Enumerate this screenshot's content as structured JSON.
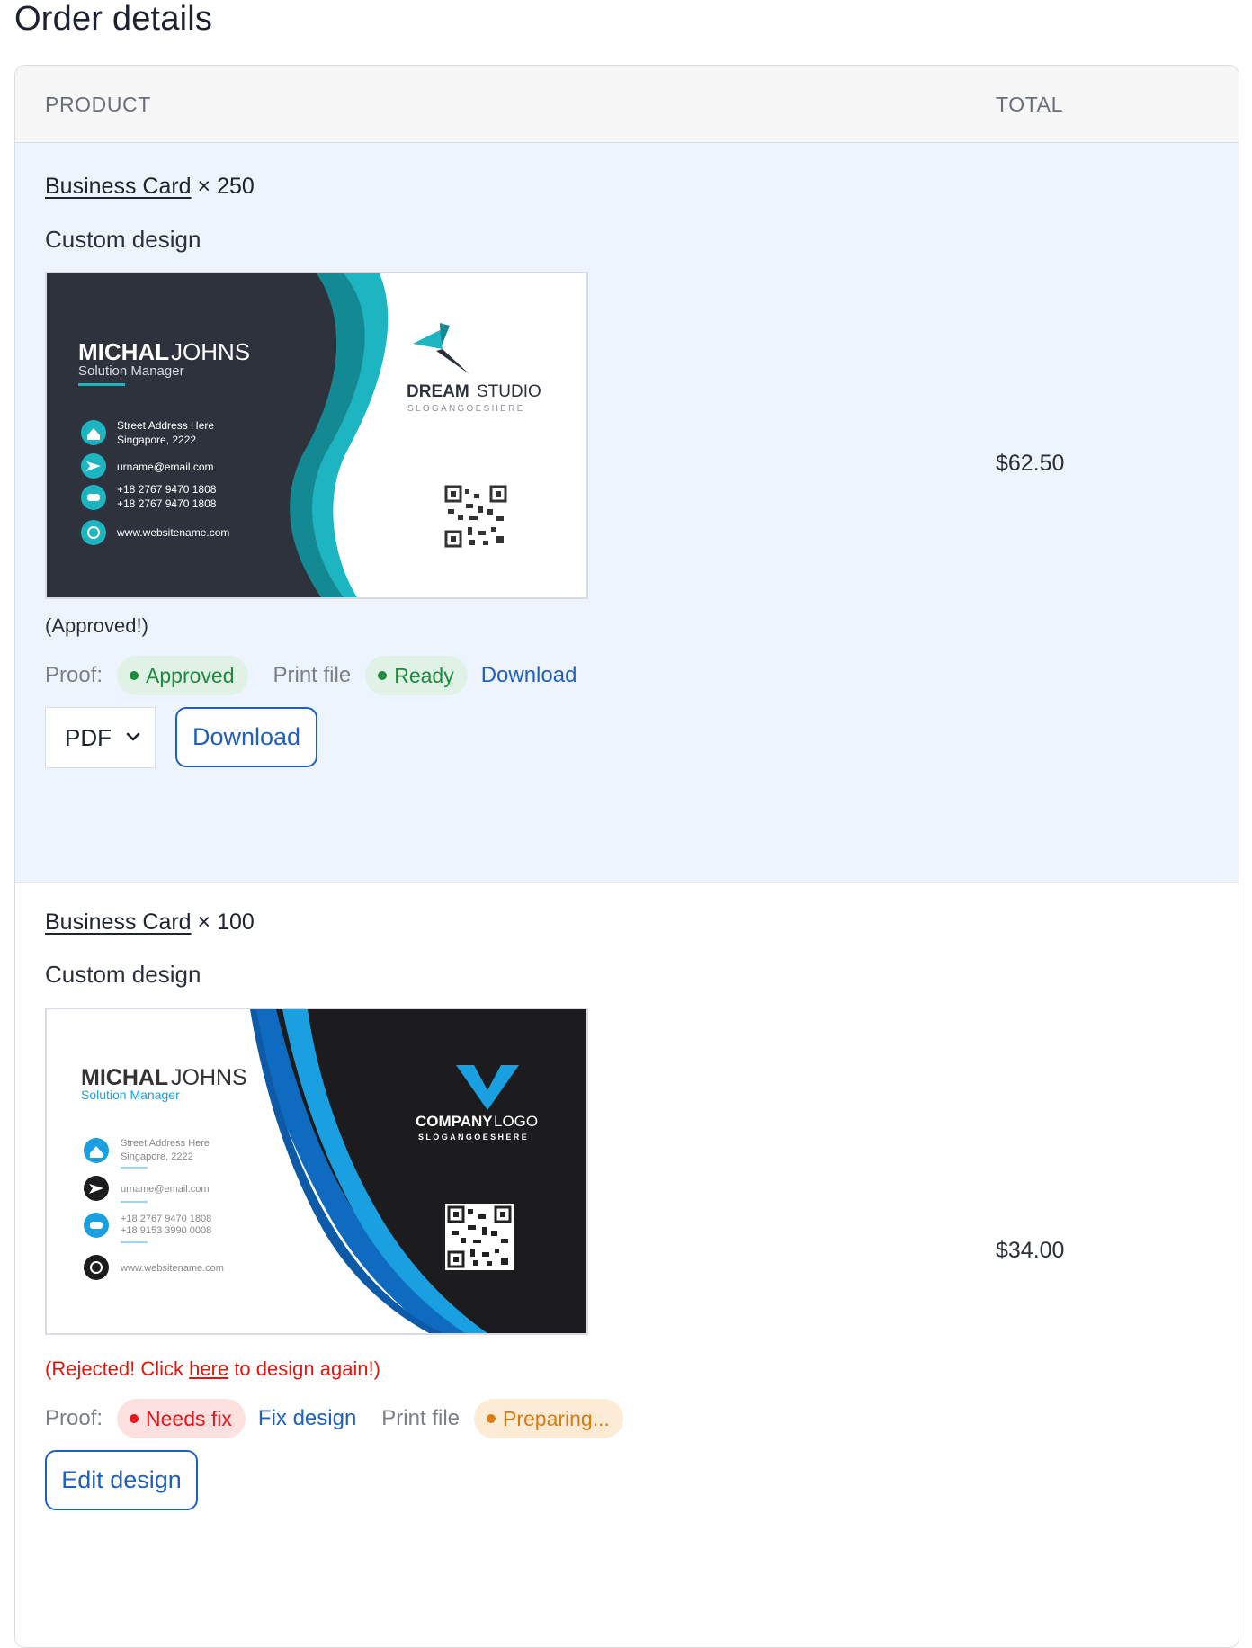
{
  "page": {
    "title": "Order details"
  },
  "table": {
    "headers": {
      "product": "PRODUCT",
      "total": "TOTAL"
    }
  },
  "items": [
    {
      "product_name": "Business Card",
      "quantity": "× 250",
      "design_type": "Custom design",
      "price": "$62.50",
      "note": "(Approved!)",
      "proof_label": "Proof:",
      "proof_status": "Approved",
      "print_file_label": "Print file",
      "print_file_status": "Ready",
      "print_file_action": "Download",
      "format_selected": "PDF",
      "download_button": "Download",
      "card_preview": {
        "name_first": "MICHAL",
        "name_last": "JOHNS",
        "role": "Solution Manager",
        "address_1": "Street Address Here",
        "address_2": "Singapore, 2222",
        "email": "urname@email.com",
        "phone_1": "+18 2767 9470 1808",
        "phone_2": "+18 2767 9470 1808",
        "website": "www.websitename.com",
        "brand_first": "DREAM",
        "brand_last": "STUDIO",
        "slogan": "SLOGANGOESHERE",
        "colors": {
          "dark": "#2d323d",
          "teal": "#1cb5c1",
          "teal_dark": "#138a93"
        }
      }
    },
    {
      "product_name": "Business Card",
      "quantity": "× 100",
      "design_type": "Custom design",
      "price": "$34.00",
      "note_before": "(Rejected! Click ",
      "note_link": "here",
      "note_after": " to design again!)",
      "proof_label": "Proof:",
      "proof_status": "Needs fix",
      "proof_action": "Fix design",
      "print_file_label": "Print file",
      "print_file_status": "Preparing...",
      "edit_button": "Edit design",
      "card_preview": {
        "name_first": "MICHAL",
        "name_last": "JOHNS",
        "role": "Solution Manager",
        "address_1": "Street Address Here",
        "address_2": "Singapore, 2222",
        "email": "urname@email.com",
        "phone_1": "+18 2767 9470 1808",
        "phone_2": "+18 9153 3990 0008",
        "website": "www.websitename.com",
        "brand_first": "COMPANY",
        "brand_last": "LOGO",
        "slogan": "SLOGANGOESHERE",
        "colors": {
          "dark": "#1c1c1e",
          "blue": "#1a9fe0",
          "blue_dark": "#0f6bc0"
        }
      }
    }
  ],
  "colors": {
    "link_blue": "#1f5fbf",
    "row_highlight": "#eef4fd",
    "reject_red": "#e0160f"
  }
}
